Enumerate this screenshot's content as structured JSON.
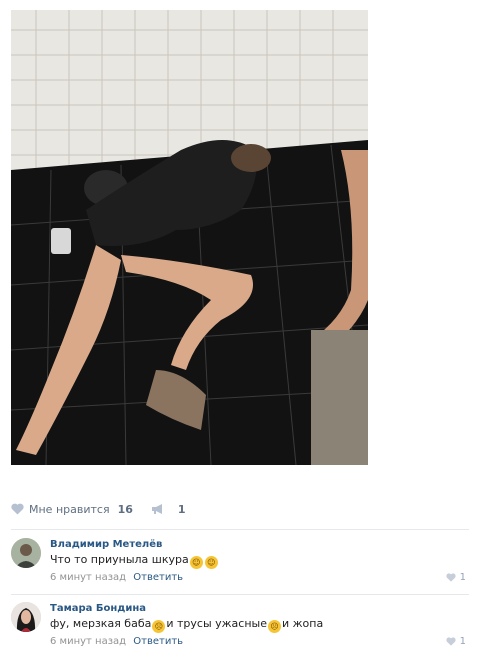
{
  "post": {
    "like_label": "Мне нравится",
    "like_count": "16",
    "repost_count": "1"
  },
  "comments": [
    {
      "author": "Владимир Метелёв",
      "text_parts": [
        "Что то приуныла шкура"
      ],
      "emoji": [
        "laughing-tears-emoji",
        "laughing-tears-emoji"
      ],
      "time": "6 минут назад",
      "reply_label": "Ответить",
      "likes": "1"
    },
    {
      "author": "Тамара Бондина",
      "text_parts": [
        "фу, мерзкая баба",
        "и трусы ужасные",
        "и жопа"
      ],
      "emoji": [
        "disgusted-emoji",
        "disgusted-emoji"
      ],
      "time": "6 минут назад",
      "reply_label": "Ответить",
      "likes": "1"
    }
  ]
}
